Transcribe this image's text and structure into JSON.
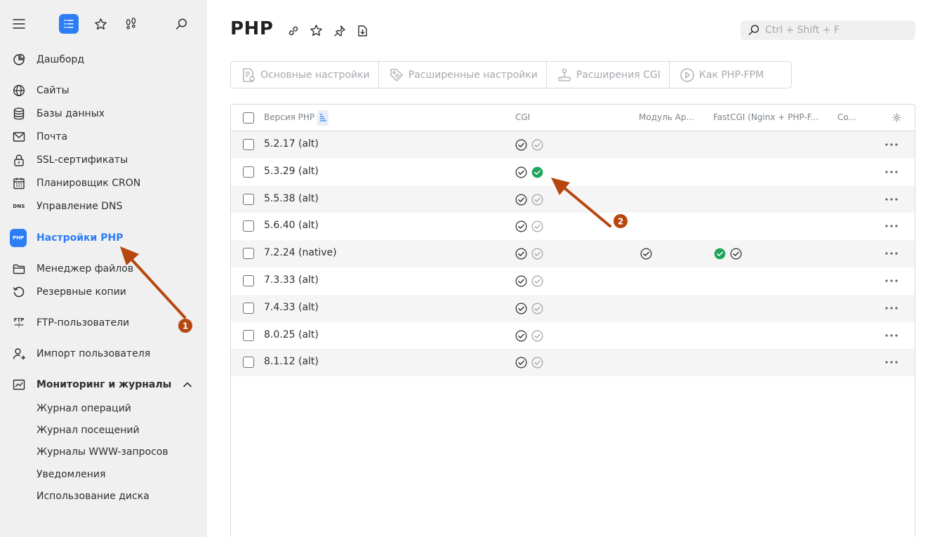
{
  "sidebar": {
    "top_icons": [
      "menu-icon",
      "list-icon",
      "star-icon",
      "footprints-icon",
      "search-icon"
    ],
    "items": [
      {
        "label": "Дашборд",
        "icon": "dashboard-icon"
      },
      {
        "label": "Сайты",
        "icon": "globe-icon"
      },
      {
        "label": "Базы данных",
        "icon": "database-icon"
      },
      {
        "label": "Почта",
        "icon": "mail-icon"
      },
      {
        "label": "SSL-сертификаты",
        "icon": "lock-icon"
      },
      {
        "label": "Планировщик CRON",
        "icon": "calendar-icon"
      },
      {
        "label": "Управление DNS",
        "icon": "dns-icon",
        "icon_text": "DNS"
      },
      {
        "label": "Настройки PHP",
        "icon": "php-icon",
        "icon_text": "PHP",
        "active": true
      },
      {
        "label": "Менеджер файлов",
        "icon": "folder-icon"
      },
      {
        "label": "Резервные копии",
        "icon": "backup-icon"
      },
      {
        "label": "FTP-пользователи",
        "icon": "ftp-icon",
        "icon_text": "FTP"
      },
      {
        "label": "Импорт пользователя",
        "icon": "user-import-icon"
      },
      {
        "label": "Мониторинг и журналы",
        "icon": "chart-icon",
        "expanded": true
      }
    ],
    "sub_items": [
      "Журнал операций",
      "Журнал посещений",
      "Журналы WWW-запросов",
      "Уведомления",
      "Использование диска"
    ]
  },
  "header": {
    "title": "PHP",
    "icons": [
      "link-icon",
      "star-icon",
      "pin-icon",
      "document-icon"
    ]
  },
  "search": {
    "placeholder": "Ctrl + Shift + F"
  },
  "toolbar": [
    {
      "label": "Основные настройки",
      "icon": "settings-doc-icon"
    },
    {
      "label": "Расширенные настройки",
      "icon": "tag-icon"
    },
    {
      "label": "Расширения CGI",
      "icon": "joystick-icon"
    },
    {
      "label": "Как PHP-FPM",
      "icon": "play-icon"
    }
  ],
  "table": {
    "headers": {
      "version": "Версия PHP",
      "cgi": "CGI",
      "apache": "Модуль Ap...",
      "fastcgi": "FastCGI (Nginx + PHP-F...",
      "co": "Co..."
    },
    "rows": [
      {
        "version": "5.2.17 (alt)",
        "cgi": [
          "check",
          "check-gray"
        ],
        "apache": [],
        "fastcgi": []
      },
      {
        "version": "5.3.29 (alt)",
        "cgi": [
          "check",
          "check-green"
        ],
        "apache": [],
        "fastcgi": []
      },
      {
        "version": "5.5.38 (alt)",
        "cgi": [
          "check",
          "check-gray"
        ],
        "apache": [],
        "fastcgi": []
      },
      {
        "version": "5.6.40 (alt)",
        "cgi": [
          "check",
          "check-gray"
        ],
        "apache": [],
        "fastcgi": []
      },
      {
        "version": "7.2.24 (native)",
        "cgi": [
          "check",
          "check-gray"
        ],
        "apache": [
          "check"
        ],
        "fastcgi": [
          "check-green",
          "check"
        ]
      },
      {
        "version": "7.3.33 (alt)",
        "cgi": [
          "check",
          "check-gray"
        ],
        "apache": [],
        "fastcgi": []
      },
      {
        "version": "7.4.33 (alt)",
        "cgi": [
          "check",
          "check-gray"
        ],
        "apache": [],
        "fastcgi": []
      },
      {
        "version": "8.0.25 (alt)",
        "cgi": [
          "check",
          "check-gray"
        ],
        "apache": [],
        "fastcgi": []
      },
      {
        "version": "8.1.12 (alt)",
        "cgi": [
          "check",
          "check-gray"
        ],
        "apache": [],
        "fastcgi": []
      }
    ]
  },
  "annotations": [
    {
      "number": "1"
    },
    {
      "number": "2"
    }
  ],
  "colors": {
    "accent": "#2d7df6",
    "success": "#1fa55a",
    "annotation": "#b5470f",
    "sidebar_bg": "#f0f0f0"
  }
}
